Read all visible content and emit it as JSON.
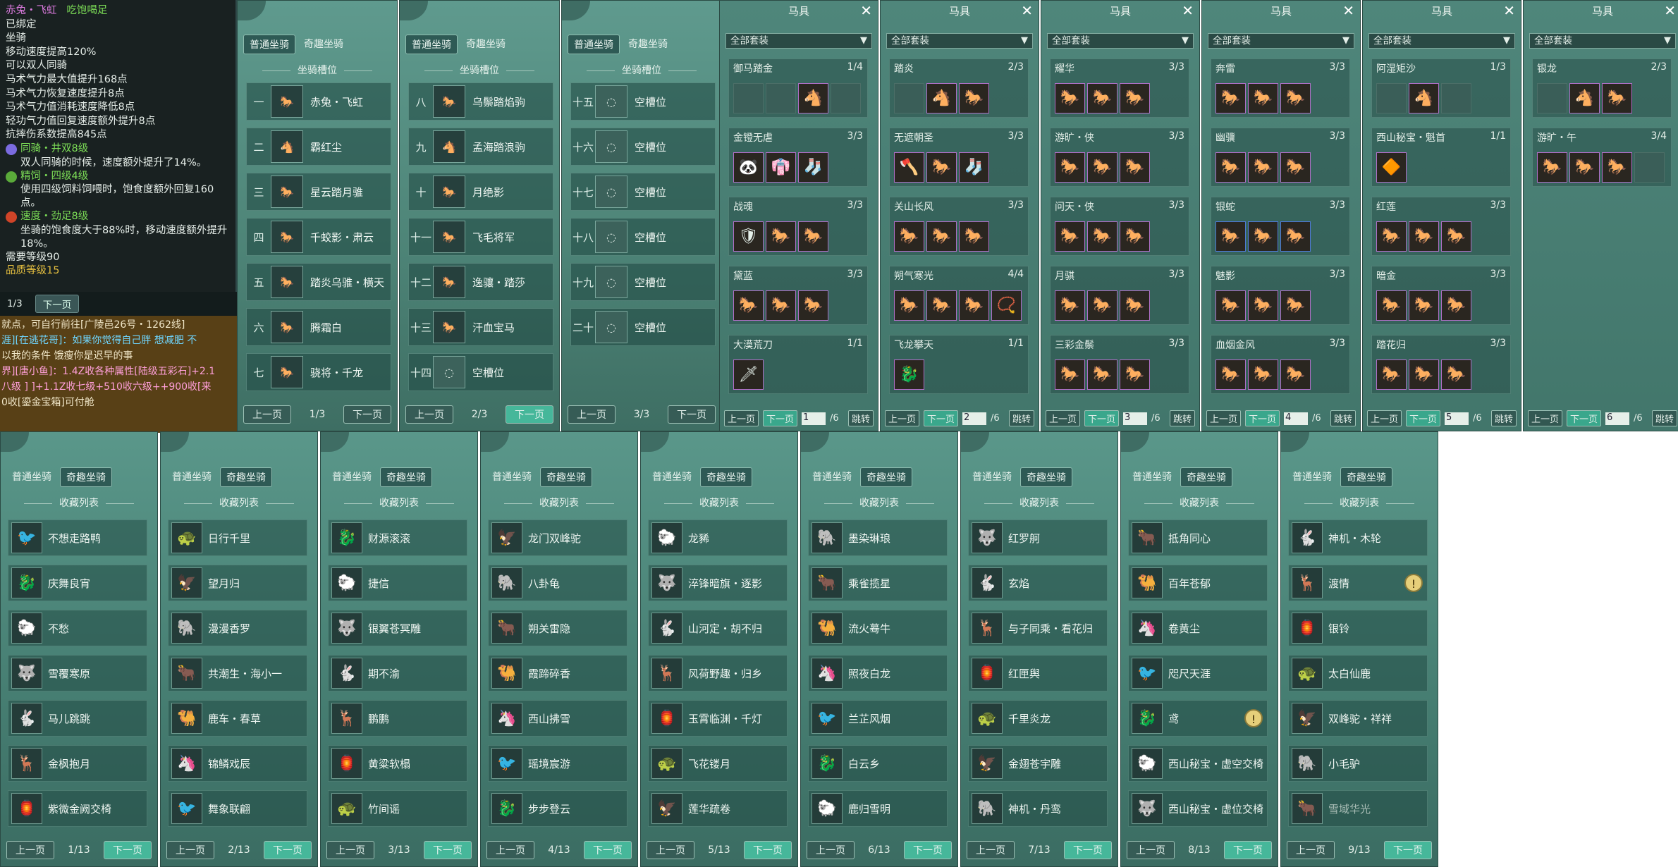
{
  "tooltip": {
    "title": "赤兔・飞虹",
    "title_status": "吃饱喝足",
    "lines": [
      "已绑定",
      "坐骑",
      "移动速度提高120%",
      "可以双人同骑",
      "马术气力最大值提升168点",
      "马术气力恢复速度提升8点",
      "马术气力值消耗速度降低8点",
      "轻功气力值回复速度额外提升8点",
      "抗摔伤系数提高845点"
    ],
    "skill1_name": "同骑・井双8级",
    "skill1_desc": "双人同骑的时候，速度额外提升了14%。",
    "skill2_name": "精饲・四级4级",
    "skill2_desc": "使用四级饲料饲喂时，饱食度额外回复160点。",
    "skill3_name": "速度・劲足8级",
    "skill3_desc": "坐骑的饱食度大于88%时，移动速度额外提升18%。",
    "req": "需要等级90",
    "quality": "品质等级15",
    "pager_page": "1/3",
    "pager_next": "下一页"
  },
  "chat": [
    "就点，可自行前往[广陵邑26号・1262线]",
    "涯][在逃花哥]：如果你觉得自己胖 想减肥 不",
    "以我的条件 饿瘦你是迟早的事",
    "界][唐小鱼]：1.4Z收各种属性[陆级五彩石]+2.1",
    "八级 ] ]+1.1Z收七级+510收六级++900收[来",
    "0收[鎏金宝箱]可付舱"
  ],
  "tabs": {
    "normal": "普通坐骑",
    "fun": "奇趣坐骑"
  },
  "slot_header": "坐骑槽位",
  "slot_panels": [
    {
      "rows": [
        {
          "num": "一",
          "name": "赤兔・飞虹"
        },
        {
          "num": "二",
          "name": "霸红尘"
        },
        {
          "num": "三",
          "name": "星云踏月骓"
        },
        {
          "num": "四",
          "name": "千蛟影・肃云"
        },
        {
          "num": "五",
          "name": "踏炎乌骓・横天"
        },
        {
          "num": "六",
          "name": "腾霜白"
        },
        {
          "num": "七",
          "name": "骁将・千龙"
        }
      ],
      "page": "1/3"
    },
    {
      "rows": [
        {
          "num": "八",
          "name": "乌鬃踏焰驹"
        },
        {
          "num": "九",
          "name": "孟海踏浪驹"
        },
        {
          "num": "十",
          "name": "月绝影"
        },
        {
          "num": "十一",
          "name": "飞毛将军"
        },
        {
          "num": "十二",
          "name": "逸骧・踏莎"
        },
        {
          "num": "十三",
          "name": "汗血宝马"
        },
        {
          "num": "十四",
          "name": "空槽位"
        }
      ],
      "page": "2/3"
    },
    {
      "rows": [
        {
          "num": "十五",
          "name": "空槽位"
        },
        {
          "num": "十六",
          "name": "空槽位"
        },
        {
          "num": "十七",
          "name": "空槽位"
        },
        {
          "num": "十八",
          "name": "空槽位"
        },
        {
          "num": "十九",
          "name": "空槽位"
        },
        {
          "num": "二十",
          "name": "空槽位"
        }
      ],
      "page": "3/3"
    }
  ],
  "pager": {
    "prev": "上一页",
    "next": "下一页",
    "jump": "跳转"
  },
  "harness_title": "马具",
  "harness_filter": "全部套装",
  "harness_panels": [
    {
      "sets": [
        {
          "name": "御马踏金",
          "count": "1/4",
          "items": [
            "e",
            "e",
            "🐴",
            "e"
          ]
        },
        {
          "name": "金镫无虐",
          "count": "3/3",
          "items": [
            "🐼",
            "👘",
            "🧦"
          ]
        },
        {
          "name": "战魂",
          "count": "3/3",
          "items": [
            "🛡",
            "🐎",
            "🐎"
          ]
        },
        {
          "name": "黛蓝",
          "count": "3/3",
          "items": [
            "🐎",
            "🐎",
            "🐎"
          ]
        },
        {
          "name": "大漠荒刀",
          "count": "1/1",
          "items": [
            "🗡"
          ]
        }
      ],
      "page": "1"
    },
    {
      "sets": [
        {
          "name": "踏炎",
          "count": "2/3",
          "items": [
            "e",
            "🐴",
            "🐎"
          ]
        },
        {
          "name": "无遮朝圣",
          "count": "3/3",
          "items": [
            "🪓",
            "🐎",
            "🧦"
          ]
        },
        {
          "name": "关山长风",
          "count": "3/3",
          "items": [
            "🐎",
            "🐎",
            "🐎"
          ]
        },
        {
          "name": "朔气寒光",
          "count": "4/4",
          "items": [
            "🐎",
            "🐎",
            "🐎",
            "📿"
          ]
        },
        {
          "name": "飞龙攀天",
          "count": "1/1",
          "items": [
            "🐉"
          ]
        }
      ],
      "page": "2"
    },
    {
      "sets": [
        {
          "name": "耀华",
          "count": "3/3",
          "items": [
            "🐎",
            "🐎",
            "🐎"
          ]
        },
        {
          "name": "游旷・侠",
          "count": "3/3",
          "items": [
            "🐎",
            "🐎",
            "🐎"
          ]
        },
        {
          "name": "问天・侠",
          "count": "3/3",
          "items": [
            "🐎",
            "🐎",
            "🐎"
          ]
        },
        {
          "name": "月骐",
          "count": "3/3",
          "items": [
            "🐎",
            "🐎",
            "🐎"
          ]
        },
        {
          "name": "三彩金鬃",
          "count": "3/3",
          "items": [
            "🐎",
            "🐎",
            "🐎"
          ]
        }
      ],
      "page": "3"
    },
    {
      "sets": [
        {
          "name": "奔雷",
          "count": "3/3",
          "items": [
            "🐎",
            "🐎",
            "🐎"
          ]
        },
        {
          "name": "幽骥",
          "count": "3/3",
          "items": [
            "🐎",
            "🐎",
            "🐎"
          ]
        },
        {
          "name": "银蛇",
          "count": "3/3",
          "items": [
            "🐎",
            "🐎",
            "🐎"
          ]
        },
        {
          "name": "魅影",
          "count": "3/3",
          "items": [
            "🐎",
            "🐎",
            "🐎"
          ]
        },
        {
          "name": "血烟金风",
          "count": "3/3",
          "items": [
            "🐎",
            "🐎",
            "🐎"
          ]
        }
      ],
      "page": "4"
    },
    {
      "sets": [
        {
          "name": "阿湿矩沙",
          "count": "1/3",
          "items": [
            "e",
            "🐴",
            "e"
          ]
        },
        {
          "name": "西山秘宝・魁首",
          "count": "1/1",
          "items": [
            "🔶"
          ]
        },
        {
          "name": "红莲",
          "count": "3/3",
          "items": [
            "🐎",
            "🐎",
            "🐎"
          ]
        },
        {
          "name": "暗金",
          "count": "3/3",
          "items": [
            "🐎",
            "🐎",
            "🐎"
          ]
        },
        {
          "name": "踏花归",
          "count": "3/3",
          "items": [
            "🐎",
            "🐎",
            "🐎"
          ]
        }
      ],
      "page": "5"
    },
    {
      "sets": [
        {
          "name": "银龙",
          "count": "2/3",
          "items": [
            "e",
            "🐴",
            "🐎"
          ]
        },
        {
          "name": "游旷・午",
          "count": "3/4",
          "items": [
            "🐎",
            "🐎",
            "🐎",
            "e"
          ]
        }
      ],
      "page": "6"
    }
  ],
  "harness_total": "/6",
  "collect_header": "收藏列表",
  "collect_panels": [
    {
      "items": [
        "不想走路鸭",
        "庆舞良宵",
        "不愁",
        "雪覆寒原",
        "马儿跳跳",
        "金枫抱月",
        "紫微金阙交椅"
      ],
      "page": "1/13"
    },
    {
      "items": [
        "日行千里",
        "望月归",
        "漫漫香罗",
        "共潮生・海小一",
        "鹿车・春草",
        "锦鳞戏辰",
        "舞象联翩"
      ],
      "page": "2/13"
    },
    {
      "items": [
        "财源滚滚",
        "捷信",
        "银翼苍冥雕",
        "期不渝",
        "鹏鹏",
        "黄粱软榻",
        "竹间谣"
      ],
      "page": "3/13"
    },
    {
      "items": [
        "龙门双峰驼",
        "八卦龟",
        "朔关雷隐",
        "霞蹄碎香",
        "西山拂雪",
        "瑶境宸游",
        "步步登云"
      ],
      "page": "4/13"
    },
    {
      "items": [
        "龙豨",
        "淬锋暗旗・逐影",
        "山河定・胡不归",
        "风荷野趣・归乡",
        "玉霄临渊・千灯",
        "飞花镂月",
        "莲华疏卷"
      ],
      "page": "5/13"
    },
    {
      "items": [
        "墨染琳琅",
        "乘雀揽星",
        "流火蓦牛",
        "照夜白龙",
        "兰芷风烟",
        "白云乡",
        "鹿归雪明"
      ],
      "page": "6/13"
    },
    {
      "items": [
        "红罗舸",
        "玄焰",
        "与子同乘・看花归",
        "红匣舆",
        "千里炎龙",
        "金翅苍宇雕",
        "神机・丹鸾"
      ],
      "page": "7/13"
    },
    {
      "items": [
        "抵角同心",
        "百年苍郁",
        "卷黄尘",
        "咫尺天涯",
        "鸢",
        "西山秘宝・虚空交椅",
        "西山秘宝・虚位交椅"
      ],
      "page": "8/13"
    },
    {
      "items": [
        "神机・木轮",
        "渡情",
        "银铃",
        "太白仙鹿",
        "双峰驼・祥祥",
        "小毛驴",
        "雪域华光"
      ],
      "page": "9/13"
    }
  ],
  "collect_icons": [
    "🐦",
    "🐉",
    "🐑",
    "🐺",
    "🐇",
    "🦌",
    "🏮",
    "🐢",
    "🦅",
    "🐘",
    "🐂",
    "🐫",
    "🦄"
  ]
}
